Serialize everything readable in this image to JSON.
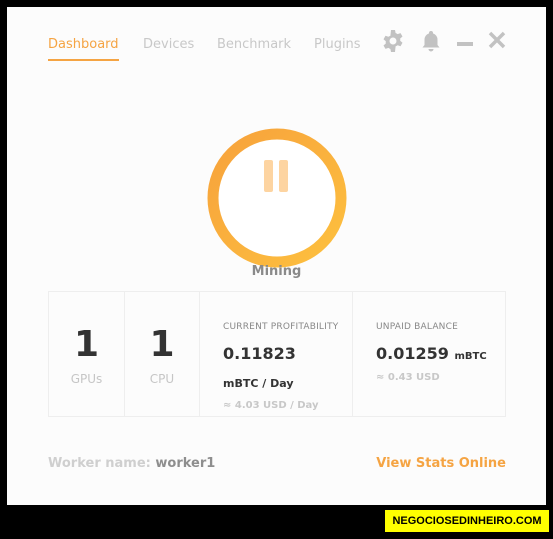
{
  "nav": {
    "tabs": [
      {
        "label": "Dashboard",
        "active": true
      },
      {
        "label": "Devices",
        "active": false
      },
      {
        "label": "Benchmark",
        "active": false
      },
      {
        "label": "Plugins",
        "active": false
      }
    ],
    "icons": [
      "gear-icon",
      "bell-icon",
      "minimize-icon",
      "close-icon"
    ]
  },
  "mining_button": {
    "state_icon": "pause-icon",
    "status_label": "Mining"
  },
  "stats": {
    "gpus": {
      "value": "1",
      "label": "GPUs"
    },
    "cpu": {
      "value": "1",
      "label": "CPU"
    },
    "profitability": {
      "header": "CURRENT PROFITABILITY",
      "value": "0.11823",
      "unit": "mBTC / Day",
      "usd": "≈ 4.03 USD / Day"
    },
    "balance": {
      "header": "UNPAID BALANCE",
      "value": "0.01259",
      "unit": "mBTC",
      "usd": "≈ 0.43 USD"
    }
  },
  "footer": {
    "worker_label": "Worker name: ",
    "worker_name": "worker1",
    "view_stats_label": "View Stats Online"
  },
  "watermark": "NEGOCIOSEDINHEIRO.COM",
  "colors": {
    "accent": "#f5a443",
    "ring_start": "#f7a23c",
    "ring_end": "#fdc03f",
    "pause": "#fdd4a1"
  }
}
